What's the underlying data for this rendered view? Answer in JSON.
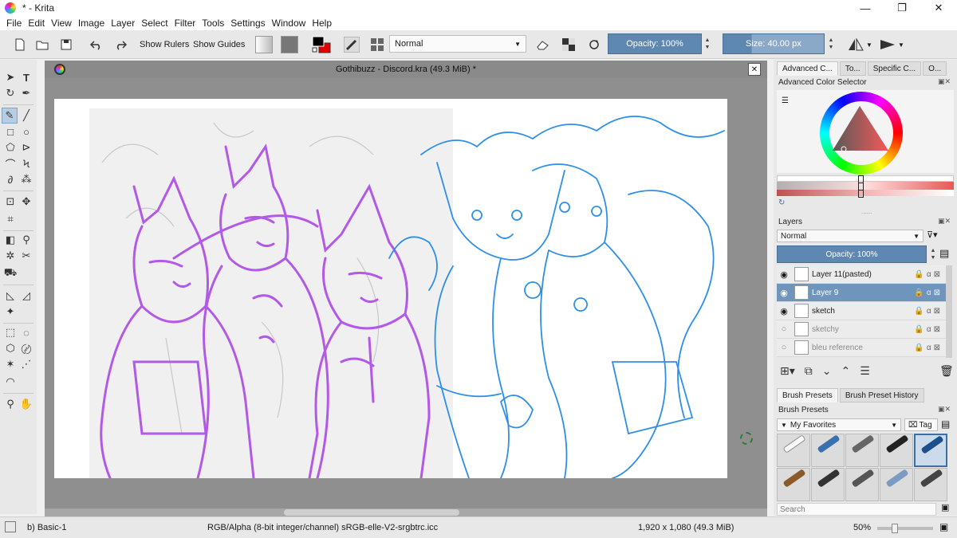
{
  "window": {
    "title": "* - Krita",
    "minimize": "—",
    "restore": "❐",
    "close": "✕"
  },
  "menu": [
    "File",
    "Edit",
    "View",
    "Image",
    "Layer",
    "Select",
    "Filter",
    "Tools",
    "Settings",
    "Window",
    "Help"
  ],
  "toolbar": {
    "show_rulers": "Show Rulers",
    "show_guides": "Show Guides",
    "blend_mode": "Normal",
    "opacity": "Opacity: 100%",
    "size": "Size: 40.00 px"
  },
  "document": {
    "tab_title": "Gothibuzz - Discord.kra (49.3 MiB) *"
  },
  "dock": {
    "top_tabs": [
      "Advanced C...",
      "To...",
      "Specific C...",
      "O..."
    ],
    "color_selector_title": "Advanced Color Selector",
    "layers_title": "Layers",
    "layers_blend": "Normal",
    "layers_opacity": "Opacity:  100%",
    "layers": [
      {
        "name": "Layer 11(pasted)",
        "visible": true,
        "selected": false
      },
      {
        "name": "Layer 9",
        "visible": true,
        "selected": true
      },
      {
        "name": "sketch",
        "visible": true,
        "selected": false
      },
      {
        "name": "sketchy",
        "visible": false,
        "selected": false
      },
      {
        "name": "bleu reference",
        "visible": false,
        "selected": false
      }
    ],
    "brush_tabs": [
      "Brush Presets",
      "Brush Preset History"
    ],
    "brush_presets_title": "Brush Presets",
    "favorites": "My Favorites",
    "tag": "Tag",
    "search_placeholder": "Search"
  },
  "status": {
    "preset": "b) Basic-1",
    "color_space": "RGB/Alpha (8-bit integer/channel)  sRGB-elle-V2-srgbtrc.icc",
    "dimensions": "1,920 x 1,080 (49.3 MiB)",
    "zoom": "50%"
  },
  "colors": {
    "accent_blue": "#5e88b2",
    "sketch_purple": "#b259e8",
    "lineart_blue": "#2e8fe6"
  }
}
